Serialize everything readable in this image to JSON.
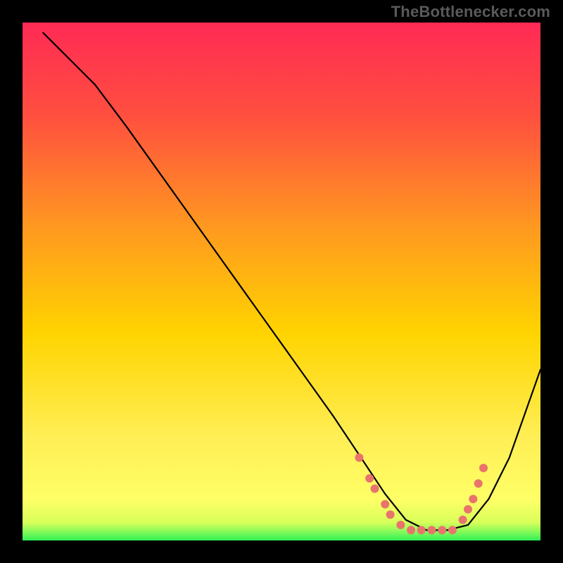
{
  "watermark": "TheBottlenecker.com",
  "colors": {
    "frame": "#000000",
    "curve": "#000000",
    "marker": "#e9746c",
    "grad_top": "#ff2a55",
    "grad_mid": "#ffd400",
    "grad_low": "#ffff66",
    "grad_bottom": "#2fef55"
  },
  "chart_data": {
    "type": "line",
    "title": "",
    "xlabel": "",
    "ylabel": "",
    "xlim": [
      0,
      100
    ],
    "ylim": [
      0,
      100
    ],
    "grid": false,
    "legend_position": "none",
    "series": [
      {
        "name": "curve",
        "x": [
          4,
          8,
          10,
          14,
          20,
          30,
          40,
          50,
          60,
          66,
          70,
          74,
          78,
          82,
          86,
          90,
          94,
          100
        ],
        "y": [
          98,
          94,
          92,
          88,
          80,
          66,
          52,
          38,
          24,
          15,
          9,
          4,
          2,
          2,
          3,
          8,
          16,
          33
        ]
      }
    ],
    "markers": [
      {
        "x": 65,
        "y": 16
      },
      {
        "x": 67,
        "y": 12
      },
      {
        "x": 68,
        "y": 10
      },
      {
        "x": 70,
        "y": 7
      },
      {
        "x": 71,
        "y": 5
      },
      {
        "x": 73,
        "y": 3
      },
      {
        "x": 75,
        "y": 2
      },
      {
        "x": 77,
        "y": 2
      },
      {
        "x": 79,
        "y": 2
      },
      {
        "x": 81,
        "y": 2
      },
      {
        "x": 83,
        "y": 2
      },
      {
        "x": 85,
        "y": 4
      },
      {
        "x": 86,
        "y": 6
      },
      {
        "x": 87,
        "y": 8
      },
      {
        "x": 88,
        "y": 11
      },
      {
        "x": 89,
        "y": 14
      }
    ]
  }
}
